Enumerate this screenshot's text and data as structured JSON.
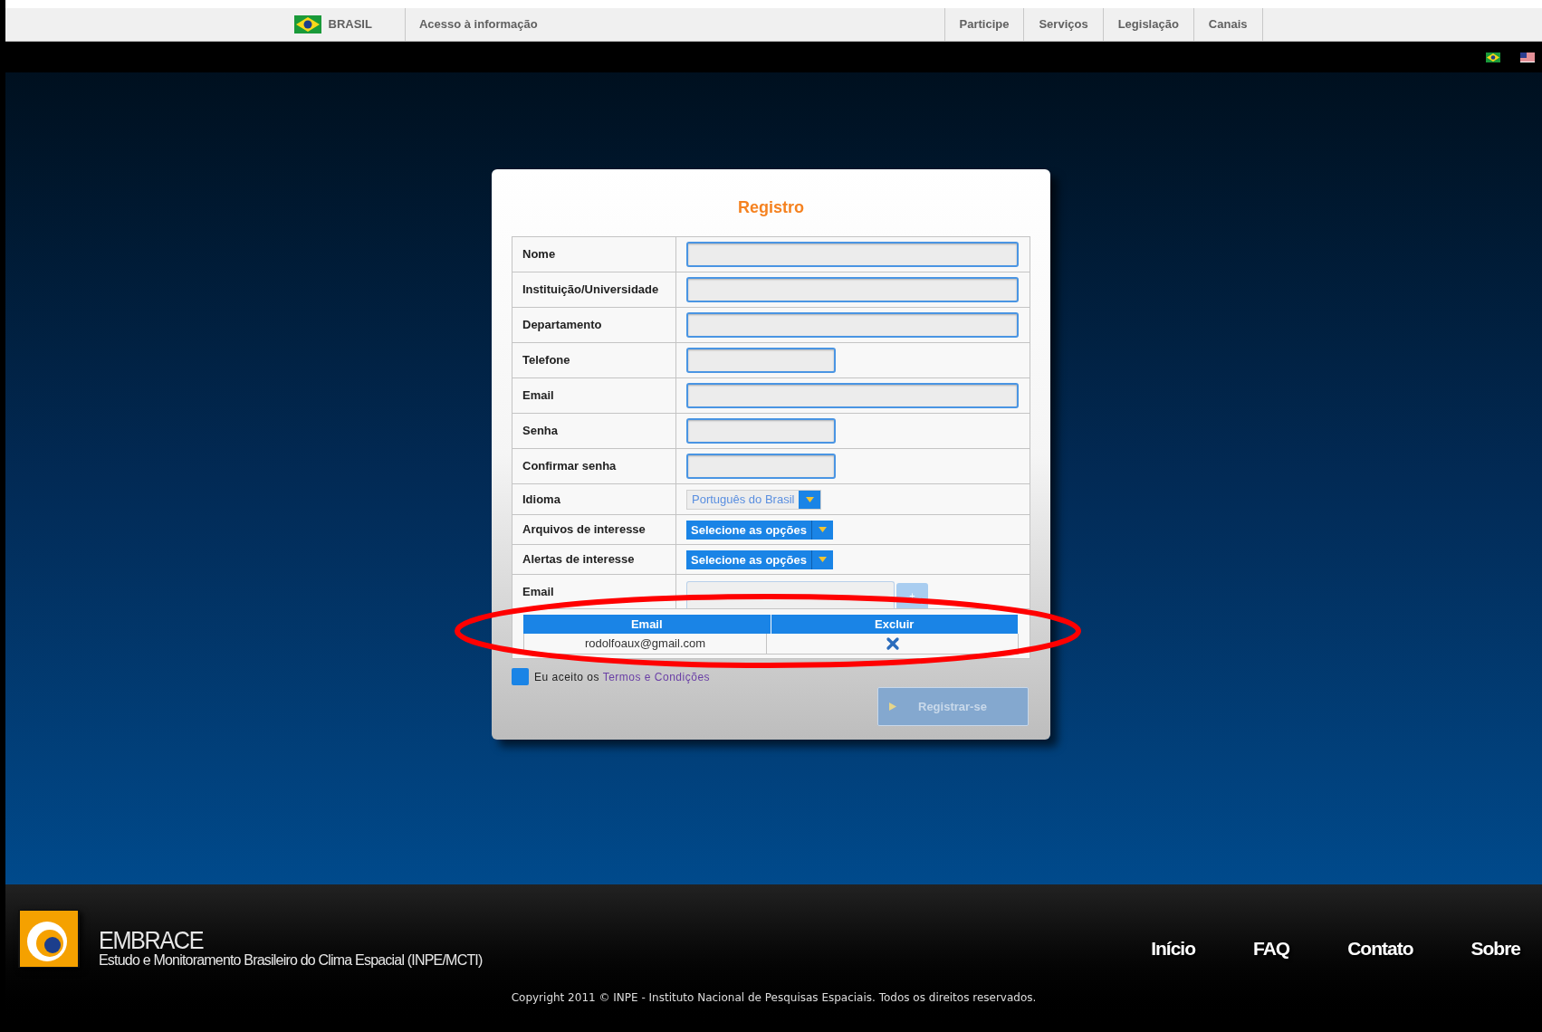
{
  "top_bar": {
    "country": "BRASIL",
    "access_link": "Acesso à informação",
    "links": [
      "Participe",
      "Serviços",
      "Legislação",
      "Canais"
    ]
  },
  "form": {
    "title": "Registro",
    "fields": [
      {
        "label": "Nome",
        "kind": "long"
      },
      {
        "label": "Instituição/Universidade",
        "kind": "long"
      },
      {
        "label": "Departamento",
        "kind": "long"
      },
      {
        "label": "Telefone",
        "kind": "short"
      },
      {
        "label": "Email",
        "kind": "long"
      },
      {
        "label": "Senha",
        "kind": "short"
      },
      {
        "label": "Confirmar senha",
        "kind": "short"
      },
      {
        "label": "Idioma",
        "kind": "dropdown",
        "value": "Português do Brasil"
      },
      {
        "label": "Arquivos de interesse",
        "kind": "multiselect",
        "value": "Selecione as opções"
      },
      {
        "label": "Alertas de interesse",
        "kind": "multiselect",
        "value": "Selecione as opções"
      },
      {
        "label": "Email",
        "kind": "adder",
        "button": "+"
      }
    ],
    "email_table": {
      "columns": [
        "Email",
        "Excluir"
      ],
      "rows": [
        {
          "email": "rodolfoaux@gmail.com"
        }
      ]
    },
    "terms": {
      "checked": false,
      "text": "Eu aceito os",
      "link": "Termos e Condições"
    },
    "submit": {
      "label": "Registrar-se",
      "disabled": true
    }
  },
  "footer": {
    "title": "EMBRACE",
    "subtitle": "Estudo e Monitoramento Brasileiro do Clima Espacial (INPE/MCTI)",
    "links": [
      "Início",
      "FAQ",
      "Contato",
      "Sobre"
    ],
    "copyright": "Copyright 2011 © INPE - Instituto Nacional de Pesquisas Espaciais. Todos os direitos reservados."
  }
}
